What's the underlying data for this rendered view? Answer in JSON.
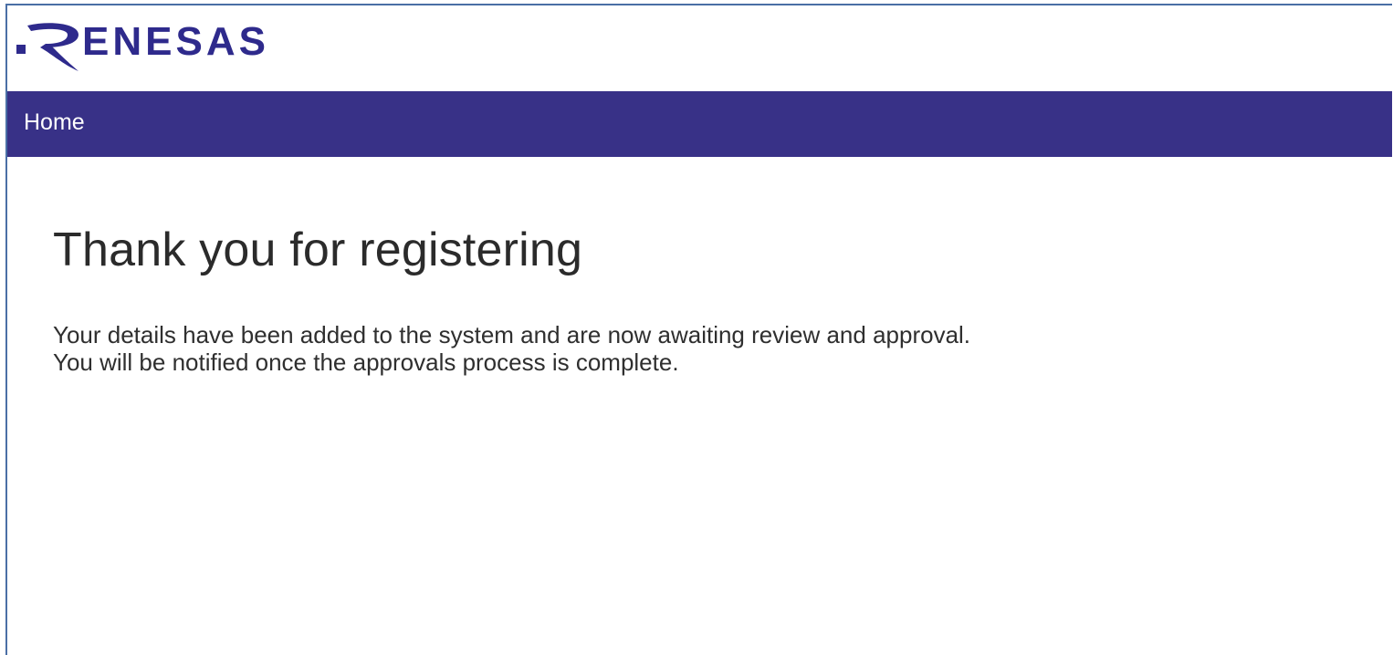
{
  "header": {
    "logo_text": "RENESAS",
    "brand_color": "#2e2a8c"
  },
  "nav": {
    "home_label": "Home",
    "bar_color": "#383187"
  },
  "main": {
    "title": "Thank you for registering",
    "message_line_1": "Your details have been added to the system and are now awaiting review and approval.",
    "message_line_2": "You will be notified once the approvals process is complete."
  }
}
